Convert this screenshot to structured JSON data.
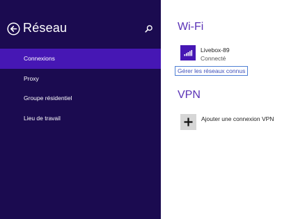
{
  "sidebar": {
    "title": "Réseau",
    "back_icon": "back-arrow-circle-icon",
    "search_icon": "search-icon",
    "items": [
      {
        "label": "Connexions",
        "active": true
      },
      {
        "label": "Proxy",
        "active": false
      },
      {
        "label": "Groupe résidentiel",
        "active": false
      },
      {
        "label": "Lieu de travail",
        "active": false
      }
    ]
  },
  "main": {
    "wifi": {
      "title": "Wi-Fi",
      "network": {
        "name": "Livebox-89",
        "status": "Connecté",
        "icon": "wifi-signal-icon"
      },
      "manage_link": "Gérer les réseaux connus"
    },
    "vpn": {
      "title": "VPN",
      "add_label": "Ajouter une connexion VPN",
      "add_icon": "plus-icon"
    }
  },
  "colors": {
    "sidebar_bg": "#1b0b50",
    "accent": "#4617b4",
    "heading": "#5a32b6",
    "link": "#3b4db8"
  }
}
